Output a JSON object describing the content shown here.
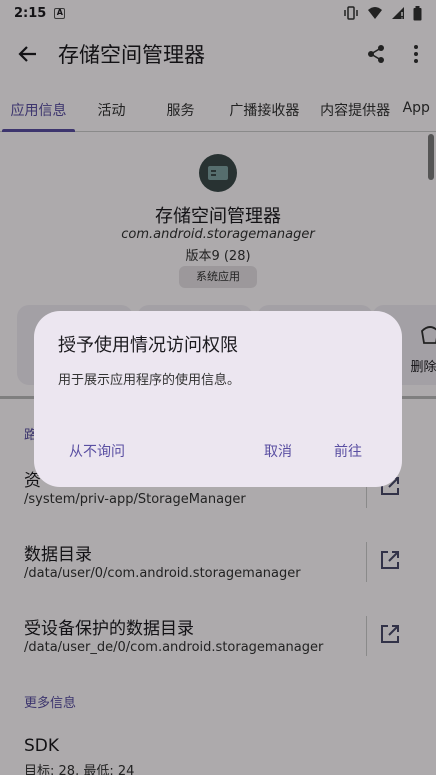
{
  "status_bar": {
    "time": "2:15",
    "notification_glyph": "A"
  },
  "app_bar": {
    "title": "存储空间管理器"
  },
  "tabs": [
    {
      "label": "应用信息",
      "active": true
    },
    {
      "label": "活动",
      "active": false
    },
    {
      "label": "服务",
      "active": false
    },
    {
      "label": "广播接收器",
      "active": false
    },
    {
      "label": "内容提供器",
      "active": false
    },
    {
      "label": "App",
      "active": false
    }
  ],
  "app_info": {
    "name": "存储空间管理器",
    "package": "com.android.storagemanager",
    "version": "版本9 (28)",
    "tag": "系统应用"
  },
  "actions": {
    "uninstall_label": "删除数"
  },
  "sections": {
    "paths_header": "路",
    "paths": [
      {
        "title": "资",
        "path": "/system/priv-app/StorageManager"
      },
      {
        "title": "数据目录",
        "path": "/data/user/0/com.android.storagemanager"
      },
      {
        "title": "受设备保护的数据目录",
        "path": "/data/user_de/0/com.android.storagemanager"
      }
    ],
    "more_header": "更多信息",
    "sdk": {
      "title": "SDK",
      "detail": "目标: 28, 最低: 24"
    }
  },
  "dialog": {
    "title": "授予使用情况访问权限",
    "message": "用于展示应用程序的使用信息。",
    "never_ask": "从不询问",
    "cancel": "取消",
    "proceed": "前往"
  },
  "colors": {
    "accent": "#5a4fa2",
    "dialog_bg": "#ece6f0",
    "scrim": "rgba(0,0,0,0.32)"
  }
}
